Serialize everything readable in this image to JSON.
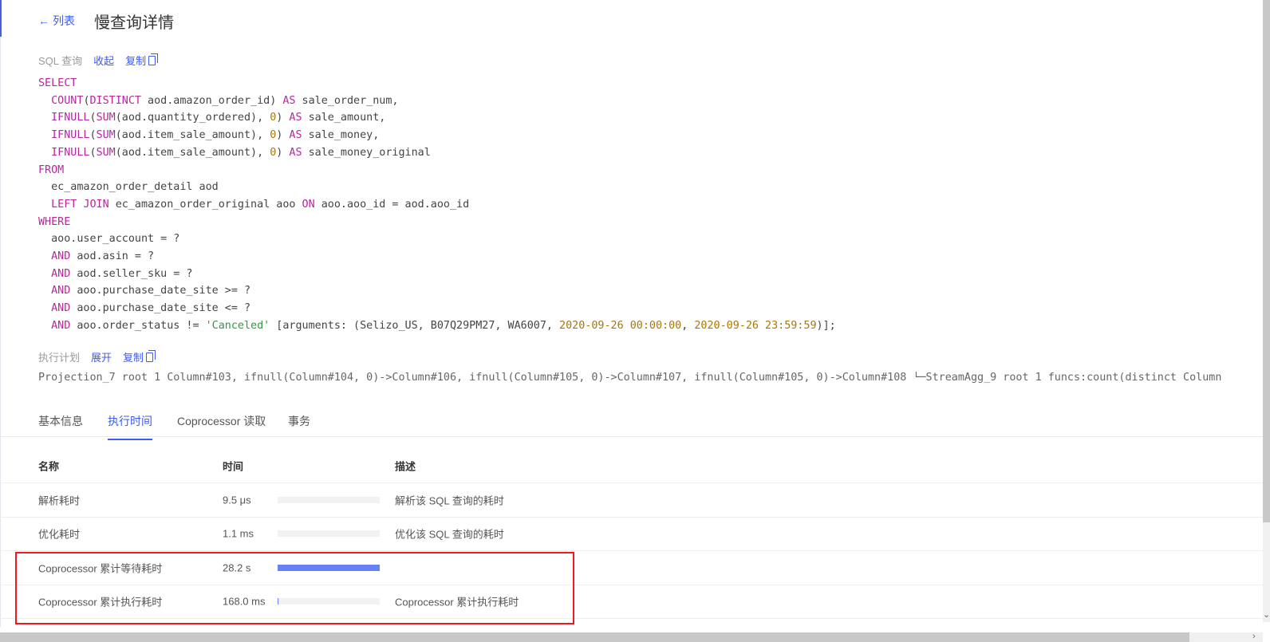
{
  "header": {
    "back_label": "列表",
    "title": "慢查询详情"
  },
  "sql_section": {
    "label": "SQL 查询",
    "collapse": "收起",
    "copy": "复制"
  },
  "sql_lines": [
    [
      [
        "kw",
        "SELECT"
      ]
    ],
    [
      [
        "t",
        "  "
      ],
      [
        "kw",
        "COUNT"
      ],
      [
        "t",
        "("
      ],
      [
        "kw",
        "DISTINCT"
      ],
      [
        "t",
        " aod.amazon_order_id) "
      ],
      [
        "kw",
        "AS"
      ],
      [
        "t",
        " sale_order_num,"
      ]
    ],
    [
      [
        "t",
        "  "
      ],
      [
        "kw",
        "IFNULL"
      ],
      [
        "t",
        "("
      ],
      [
        "kw",
        "SUM"
      ],
      [
        "t",
        "(aod.quantity_ordered), "
      ],
      [
        "num",
        "0"
      ],
      [
        "t",
        ") "
      ],
      [
        "kw",
        "AS"
      ],
      [
        "t",
        " sale_amount,"
      ]
    ],
    [
      [
        "t",
        "  "
      ],
      [
        "kw",
        "IFNULL"
      ],
      [
        "t",
        "("
      ],
      [
        "kw",
        "SUM"
      ],
      [
        "t",
        "(aod.item_sale_amount), "
      ],
      [
        "num",
        "0"
      ],
      [
        "t",
        ") "
      ],
      [
        "kw",
        "AS"
      ],
      [
        "t",
        " sale_money,"
      ]
    ],
    [
      [
        "t",
        "  "
      ],
      [
        "kw",
        "IFNULL"
      ],
      [
        "t",
        "("
      ],
      [
        "kw",
        "SUM"
      ],
      [
        "t",
        "(aod.item_sale_amount), "
      ],
      [
        "num",
        "0"
      ],
      [
        "t",
        ") "
      ],
      [
        "kw",
        "AS"
      ],
      [
        "t",
        " sale_money_original"
      ]
    ],
    [
      [
        "kw",
        "FROM"
      ]
    ],
    [
      [
        "t",
        "  ec_amazon_order_detail aod"
      ]
    ],
    [
      [
        "t",
        "  "
      ],
      [
        "kw",
        "LEFT JOIN"
      ],
      [
        "t",
        " ec_amazon_order_original aoo "
      ],
      [
        "kw",
        "ON"
      ],
      [
        "t",
        " aoo.aoo_id = aod.aoo_id"
      ]
    ],
    [
      [
        "kw",
        "WHERE"
      ]
    ],
    [
      [
        "t",
        "  aoo.user_account = ?"
      ]
    ],
    [
      [
        "t",
        "  "
      ],
      [
        "kw",
        "AND"
      ],
      [
        "t",
        " aod.asin = ?"
      ]
    ],
    [
      [
        "t",
        "  "
      ],
      [
        "kw",
        "AND"
      ],
      [
        "t",
        " aod.seller_sku = ?"
      ]
    ],
    [
      [
        "t",
        "  "
      ],
      [
        "kw",
        "AND"
      ],
      [
        "t",
        " aoo.purchase_date_site >= ?"
      ]
    ],
    [
      [
        "t",
        "  "
      ],
      [
        "kw",
        "AND"
      ],
      [
        "t",
        " aoo.purchase_date_site <= ?"
      ]
    ],
    [
      [
        "t",
        "  "
      ],
      [
        "kw",
        "AND"
      ],
      [
        "t",
        " aoo.order_status != "
      ],
      [
        "str",
        "'Canceled'"
      ],
      [
        "t",
        " [arguments: (Selizo_US, B07Q29PM27, WA6007, "
      ],
      [
        "num",
        "2020-09-26 00:00:00"
      ],
      [
        "t",
        ", "
      ],
      [
        "num",
        "2020-09-26 23:59:59"
      ],
      [
        "t",
        ")];"
      ]
    ]
  ],
  "plan_section": {
    "label": "执行计划",
    "expand": "展开",
    "copy": "复制",
    "text": "Projection_7 root 1 Column#103, ifnull(Column#104, 0)->Column#106, ifnull(Column#105, 0)->Column#107, ifnull(Column#105, 0)->Column#108 └─StreamAgg_9 root 1 funcs:count(distinct Column"
  },
  "tabs": [
    {
      "label": "基本信息"
    },
    {
      "label": "执行时间",
      "active": true
    },
    {
      "label": "Coprocessor 读取"
    },
    {
      "label": "事务"
    }
  ],
  "table": {
    "headers": {
      "name": "名称",
      "time": "时间",
      "desc": "描述"
    },
    "rows": [
      {
        "name": "解析耗时",
        "time": "9.5 μs",
        "fraction": 0.0,
        "desc": "解析该 SQL 查询的耗时"
      },
      {
        "name": "优化耗时",
        "time": "1.1 ms",
        "fraction": 0.0,
        "desc": "优化该 SQL 查询的耗时"
      },
      {
        "name": "Coprocessor 累计等待耗时",
        "time": "28.2 s",
        "fraction": 1.0,
        "desc": ""
      },
      {
        "name": "Coprocessor 累计执行耗时",
        "time": "168.0 ms",
        "fraction": 0.006,
        "desc": "Coprocessor 累计执行耗时"
      }
    ]
  },
  "colors": {
    "accent": "#3e5bf0",
    "bar": "#6680f5",
    "highlight": "#f0181c"
  }
}
